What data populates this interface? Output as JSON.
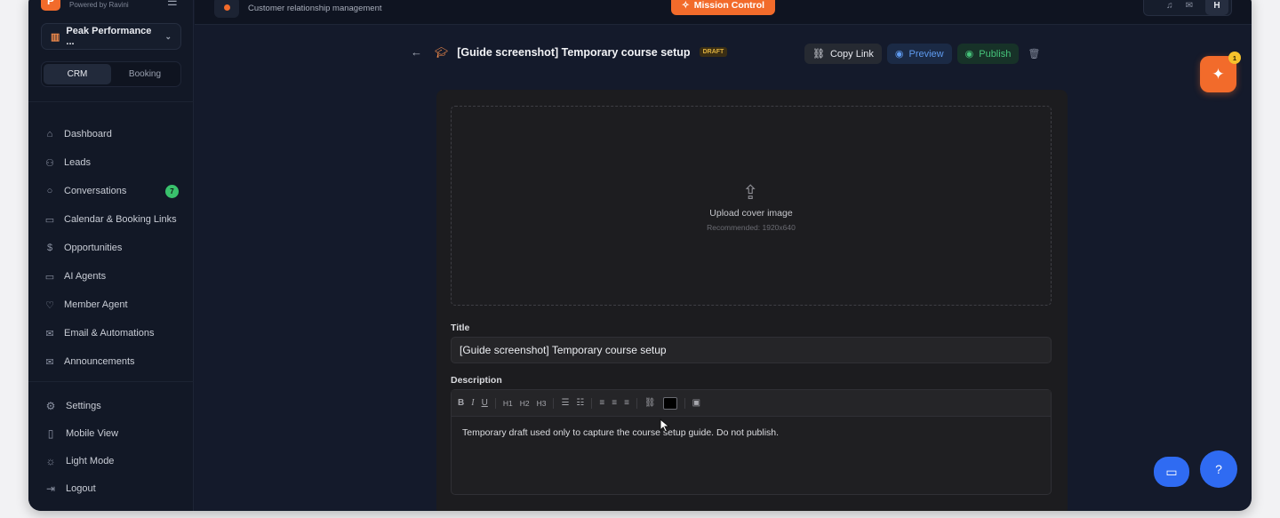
{
  "brand": {
    "logo_letter": "P",
    "subtitle": "Powered by Ravini"
  },
  "workspace": {
    "name": "Peak Performance ..."
  },
  "mode_switch": {
    "options": [
      "CRM",
      "Booking"
    ],
    "active": "CRM"
  },
  "sidebar": {
    "items": [
      {
        "label": "Dashboard",
        "icon": "home-icon"
      },
      {
        "label": "Leads",
        "icon": "users-icon"
      },
      {
        "label": "Conversations",
        "icon": "chat-icon",
        "badge": "7"
      },
      {
        "label": "Calendar & Booking Links",
        "icon": "calendar-icon"
      },
      {
        "label": "Opportunities",
        "icon": "dollar-icon"
      },
      {
        "label": "AI Agents",
        "icon": "monitor-icon"
      },
      {
        "label": "Member Agent",
        "icon": "heart-icon"
      },
      {
        "label": "Email & Automations",
        "icon": "mail-icon"
      },
      {
        "label": "Announcements",
        "icon": "mail-icon"
      }
    ],
    "bottom": [
      {
        "label": "Settings",
        "icon": "gear-icon"
      },
      {
        "label": "Mobile View",
        "icon": "phone-icon"
      },
      {
        "label": "Light Mode",
        "icon": "sun-icon"
      },
      {
        "label": "Logout",
        "icon": "logout-icon"
      }
    ]
  },
  "topbar": {
    "subtitle": "Customer relationship management",
    "mission_control": "Mission Control",
    "avatar_letter": "H"
  },
  "course": {
    "title": "[Guide screenshot] Temporary course setup",
    "status": "DRAFT",
    "copy_link": "Copy Link",
    "preview": "Preview",
    "publish": "Publish"
  },
  "upload": {
    "label": "Upload cover image",
    "recommended": "Recommended: 1920x640"
  },
  "form": {
    "title_label": "Title",
    "title_value": "[Guide screenshot] Temporary course setup",
    "description_label": "Description",
    "description_value": "Temporary draft used only to capture the course setup guide. Do not publish.",
    "toolbar": {
      "bold": "B",
      "italic": "I",
      "underline": "U",
      "h1": "H1",
      "h2": "H2",
      "h3": "H3"
    },
    "text_color": "#000000"
  },
  "ai_badge": "1",
  "colors": {
    "accent": "#f26b2b",
    "blue": "#2f6bf2",
    "success": "#39c16c",
    "draft": "#e0b23f"
  }
}
